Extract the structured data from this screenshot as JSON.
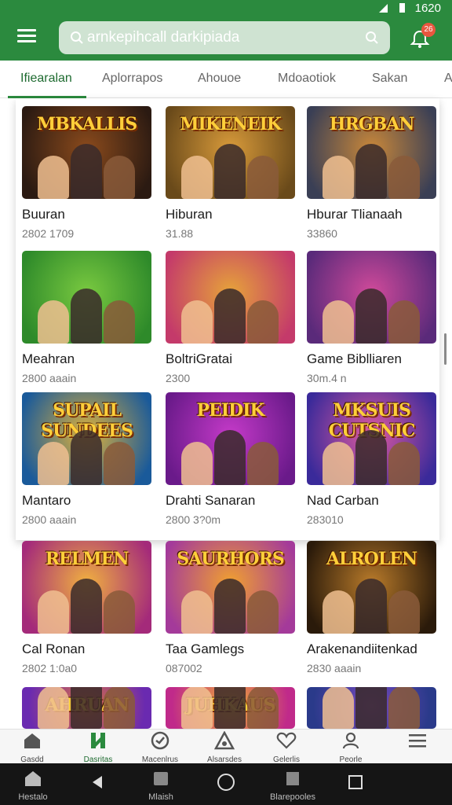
{
  "status_bar": {
    "time": "1620"
  },
  "header": {
    "search_text": "arnkepihcall darkipiada",
    "notification_count": "26",
    "accent_color": "#2b8a3e"
  },
  "tabs": [
    {
      "label": "Ifiearalan",
      "active": true
    },
    {
      "label": "Aplorrapos",
      "active": false
    },
    {
      "label": "Ahouoe",
      "active": false
    },
    {
      "label": "Mdoaotiok",
      "active": false
    },
    {
      "label": "Sakan",
      "active": false
    },
    {
      "label": "A",
      "active": false
    }
  ],
  "games": [
    {
      "thumb_title": "MBKALLIS",
      "title": "Buuran",
      "meta": "2802 1709"
    },
    {
      "thumb_title": "MIKENEIK",
      "title": "Hiburan",
      "meta": "31.88"
    },
    {
      "thumb_title": "HRGBAN",
      "title": "Hburar Tlianaah",
      "meta": "33860"
    },
    {
      "thumb_title": "",
      "title": "Meahran",
      "meta": "2800 aaain"
    },
    {
      "thumb_title": "",
      "title": "BoltriGratai",
      "meta": "2300"
    },
    {
      "thumb_title": "",
      "title": "Game Biblliaren",
      "meta": "30m.4 n"
    },
    {
      "thumb_title": "SUPAIL SUNDEES",
      "title": "Mantaro",
      "meta": "2800 aaain"
    },
    {
      "thumb_title": "PEIDIK",
      "title": "Drahti Sanaran",
      "meta": "2800 3?0m"
    },
    {
      "thumb_title": "MKSUIS CUTSNIC",
      "title": "Nad Carban",
      "meta": "283010"
    },
    {
      "thumb_title": "RELMEN",
      "title": "Cal Ronan",
      "meta": "2802 1:0a0"
    },
    {
      "thumb_title": "SAURHORS",
      "title": "Taa Gamlegs",
      "meta": "087002"
    },
    {
      "thumb_title": "ALROLEN",
      "title": "Arakenandiitenkad",
      "meta": "2830 aaain"
    },
    {
      "thumb_title": "AHRUAN",
      "title": "",
      "meta": ""
    },
    {
      "thumb_title": "JUHKAUS",
      "title": "",
      "meta": ""
    },
    {
      "thumb_title": "",
      "title": "",
      "meta": ""
    }
  ],
  "bottom_nav": [
    {
      "label": "Gasdd",
      "icon": "home-icon",
      "active": false
    },
    {
      "label": "Dasritas",
      "icon": "bookmark-icon",
      "active": true
    },
    {
      "label": "Macenlrus",
      "icon": "compass-icon",
      "active": false
    },
    {
      "label": "Alsarsdes",
      "icon": "alert-icon",
      "active": false
    },
    {
      "label": "Gelerlis",
      "icon": "heart-icon",
      "active": false
    },
    {
      "label": "Peorle",
      "icon": "user-icon",
      "active": false
    },
    {
      "label": "",
      "icon": "menu-icon",
      "active": false
    }
  ],
  "system_bar": [
    {
      "label": "Hestalo",
      "icon": "home-icon"
    },
    {
      "label": "",
      "icon": "back-icon"
    },
    {
      "label": "Mlaish",
      "icon": "apps-icon"
    },
    {
      "label": "",
      "icon": "circle-home-icon"
    },
    {
      "label": "Blarepooles",
      "icon": "box-icon"
    },
    {
      "label": "",
      "icon": "square-icon"
    }
  ]
}
